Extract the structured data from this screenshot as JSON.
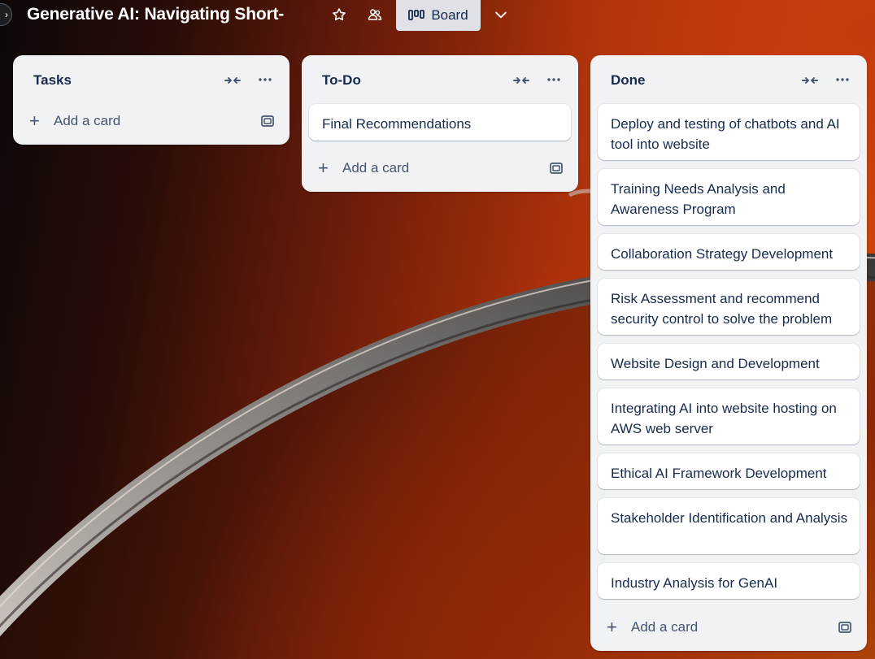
{
  "header": {
    "board_title": "Generative AI: Navigating Short-",
    "view_label": "Board",
    "icons": [
      "sidebar-toggle-icon",
      "star-icon",
      "workspace-visibility-icon",
      "board-view-icon",
      "chevron-down-icon"
    ]
  },
  "lists": [
    {
      "title": "Tasks",
      "cards": [],
      "add_label": "Add a card"
    },
    {
      "title": "To-Do",
      "cards": [
        "Final Recommendations"
      ],
      "add_label": "Add a card"
    },
    {
      "title": "Done",
      "cards": [
        "Deploy and testing of chatbots and AI tool into website",
        "Training Needs Analysis and Awareness Program",
        "Collaboration Strategy Development",
        "Risk Assessment and recommend security control to solve the problem",
        "Website Design and Development",
        "Integrating AI into website hosting on AWS web server",
        "Ethical AI Framework Development",
        "Stakeholder Identification and Analysis",
        "Industry Analysis for GenAI"
      ],
      "add_label": "Add a card"
    }
  ],
  "colors": {
    "list_bg": "#f1f2f4",
    "card_bg": "#ffffff",
    "text": "#172b4d",
    "muted_text": "#44546f",
    "view_button_bg": "#dfe1e6"
  }
}
